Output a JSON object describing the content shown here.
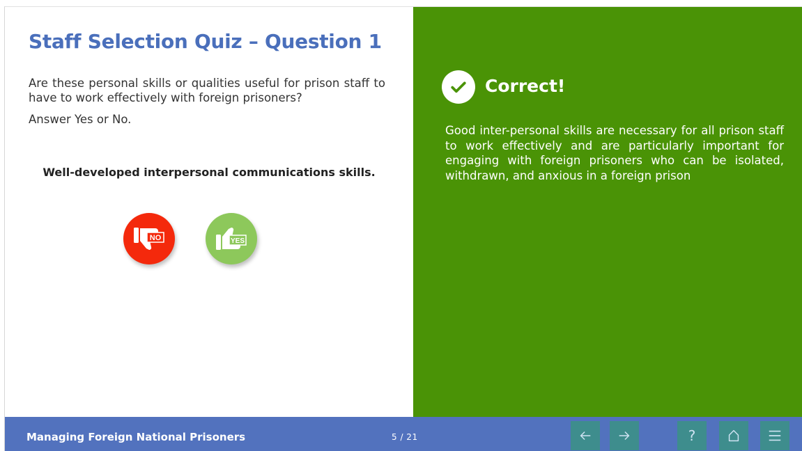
{
  "slide": {
    "title": "Staff Selection Quiz – Question 1",
    "question": "Are these personal skills or qualities useful for prison staff to have to work effectively with foreign prisoners?",
    "instruction": "Answer Yes or No.",
    "statement": "Well-developed interpersonal communications skills."
  },
  "choices": {
    "no_label": "NO",
    "no_icon": "thumbs-down-icon",
    "no_color": "#f4290c",
    "yes_label": "YES",
    "yes_icon": "thumbs-up-icon",
    "yes_color": "#8dc85b"
  },
  "feedback": {
    "status": "Correct!",
    "icon": "checkmark-icon",
    "text": "Good inter-personal skills are necessary for all prison staff to work effectively and are particularly important for engaging with foreign prisoners who can be isolated, withdrawn, and anxious in a foreign prison",
    "background_color": "#4a9306"
  },
  "footer": {
    "course_title": "Managing Foreign National Prisoners",
    "page_indicator": "5 / 21",
    "background_color": "#5272be",
    "buttons": {
      "prev_icon": "arrow-left-icon",
      "next_icon": "arrow-right-icon",
      "help_label": "?",
      "home_icon": "home-icon",
      "menu_icon": "menu-icon"
    }
  }
}
